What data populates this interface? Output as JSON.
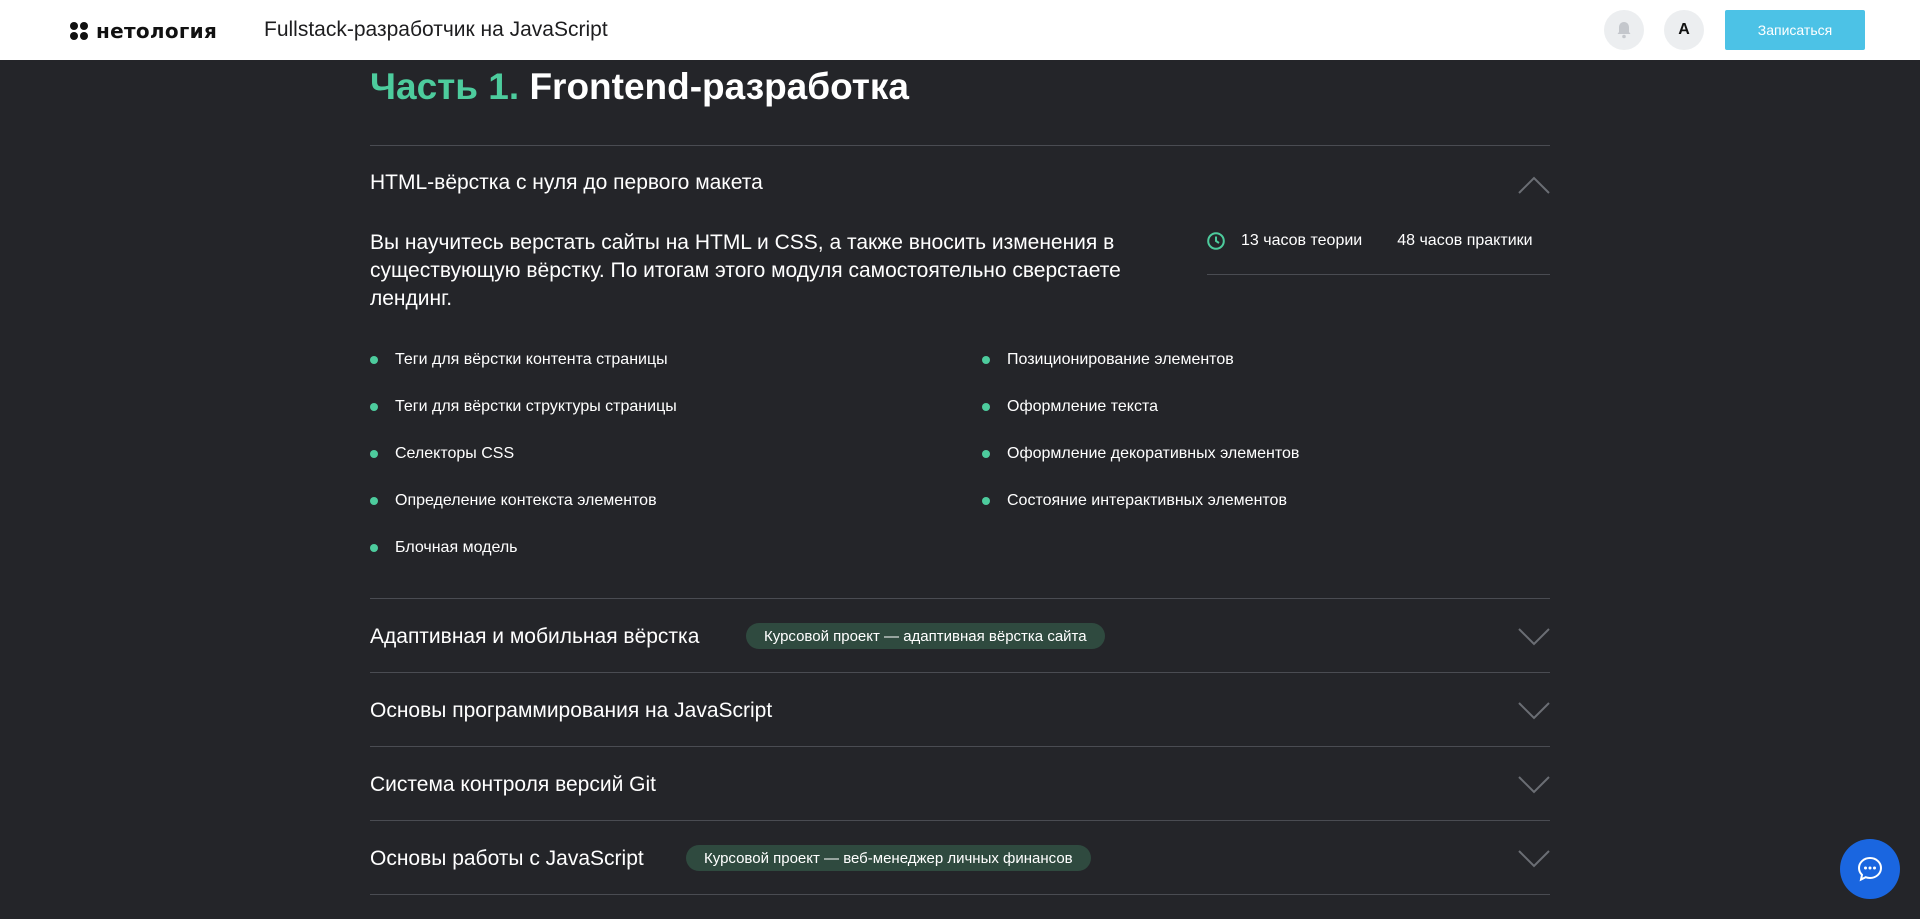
{
  "header": {
    "logo_text": "нетология",
    "course_title": "Fullstack-разработчик на JavaScript",
    "avatar_letter": "A",
    "enroll_label": "Записаться"
  },
  "part": {
    "number_label": "Часть 1.",
    "title": "Frontend-разработка"
  },
  "modules": [
    {
      "title": "HTML-вёрстка с нуля до первого макета",
      "expanded": true,
      "description": "Вы научитесь верстать сайты на HTML и CSS, а также вносить изменения в существующую вёрстку. По итогам этого модуля самостоятельно сверстаете лендинг.",
      "theory_hours": "13 часов теории",
      "practice_hours": "48 часов практики",
      "topics_left": [
        "Теги для вёрстки контента страницы",
        "Теги для вёрстки структуры страницы",
        "Селекторы CSS",
        "Определение контекста элементов",
        "Блочная модель"
      ],
      "topics_right": [
        "Позиционирование элементов",
        "Оформление текста",
        "Оформление декоративных элементов",
        "Состояние интерактивных элементов"
      ]
    },
    {
      "title": "Адаптивная и мобильная вёрстка",
      "expanded": false,
      "badge": "Курсовой проект — адаптивная вёрстка сайта"
    },
    {
      "title": "Основы программирования на JavaScript",
      "expanded": false
    },
    {
      "title": "Система контроля версий Git",
      "expanded": false
    },
    {
      "title": "Основы работы с JavaScript",
      "expanded": false,
      "badge": "Курсовой проект — веб-менеджер личных финансов"
    }
  ],
  "colors": {
    "accent": "#4dcc9d",
    "background": "#242529",
    "enroll_button": "#4cc2e6",
    "chat_button": "#1a66e0",
    "badge_bg": "#2f4a3f"
  },
  "icons": {
    "bell": "bell-icon",
    "clock": "clock-icon",
    "chevron_up": "chevron-up-icon",
    "chevron_down": "chevron-down-icon",
    "chat": "chat-bubble-icon"
  }
}
